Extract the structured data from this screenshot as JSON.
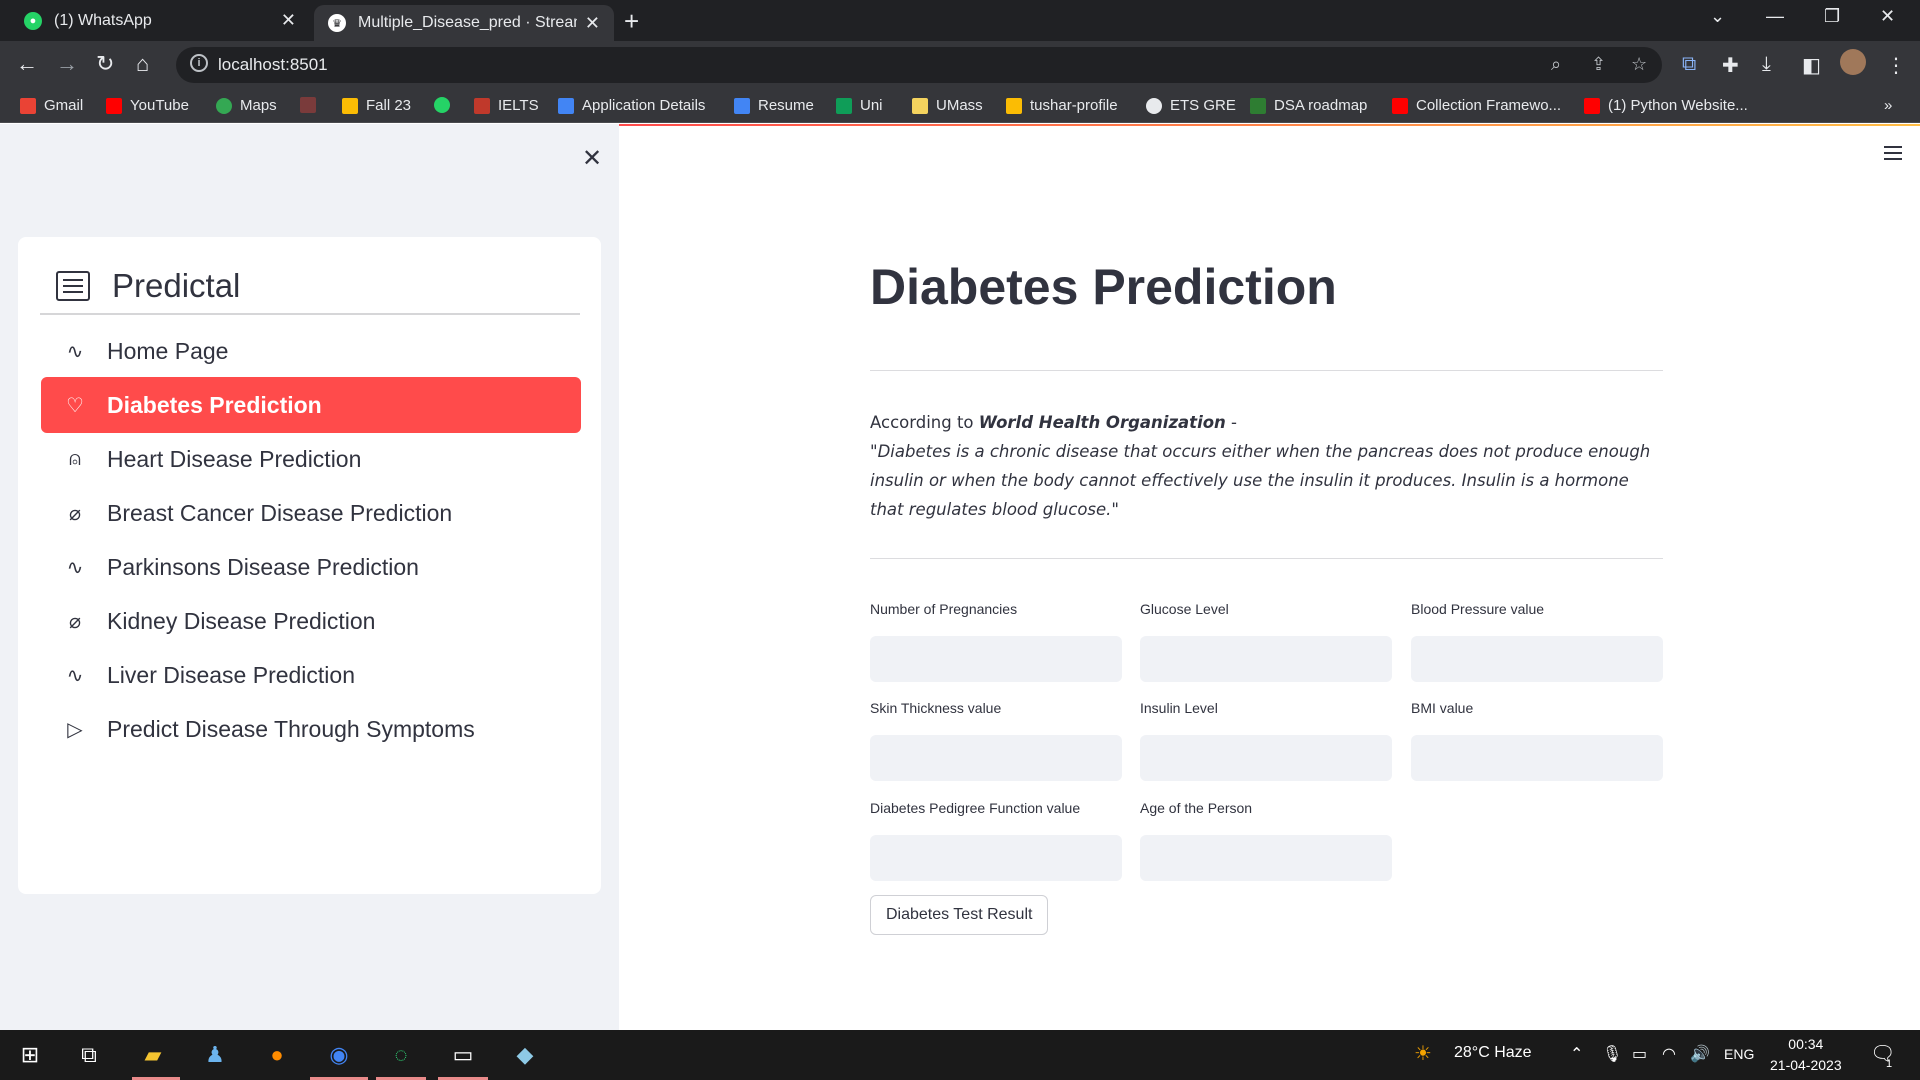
{
  "browser": {
    "tabs": [
      {
        "title": "(1) WhatsApp",
        "active": false
      },
      {
        "title": "Multiple_Disease_pred · Streamlit",
        "active": true
      }
    ],
    "url": "localhost:8501",
    "bookmarks": [
      "Gmail",
      "YouTube",
      "Maps",
      "Fall 23",
      "IELTS",
      "Application Details",
      "Resume",
      "Uni",
      "UMass",
      "tushar-profile",
      "ETS GRE",
      "DSA roadmap",
      "Collection Framewo...",
      "(1) Python Website..."
    ],
    "more_bookmarks": "»"
  },
  "sidebar": {
    "menu_title": "Predictal",
    "items": [
      {
        "label": "Home Page",
        "icon": "activity-icon",
        "active": false
      },
      {
        "label": "Diabetes Prediction",
        "icon": "heart-icon",
        "active": true
      },
      {
        "label": "Heart Disease Prediction",
        "icon": "person-icon",
        "active": false
      },
      {
        "label": "Breast Cancer Disease Prediction",
        "icon": "bandaid-icon",
        "active": false
      },
      {
        "label": "Parkinsons Disease Prediction",
        "icon": "activity-icon",
        "active": false
      },
      {
        "label": "Kidney Disease Prediction",
        "icon": "bandaid-icon",
        "active": false
      },
      {
        "label": "Liver Disease Prediction",
        "icon": "activity-icon",
        "active": false
      },
      {
        "label": "Predict Disease Through Symptoms",
        "icon": "play-icon",
        "active": false
      }
    ]
  },
  "main": {
    "title": "Diabetes Prediction",
    "intro_prefix": "According to ",
    "intro_source": "World Health Organization",
    "intro_suffix": " -",
    "quote": "\"Diabetes is a chronic disease that occurs either when the pancreas does not produce enough insulin or when the body cannot effectively use the insulin it produces. Insulin is a hormone that regulates blood glucose.\"",
    "fields": [
      {
        "label": "Number of Pregnancies",
        "value": ""
      },
      {
        "label": "Glucose Level",
        "value": ""
      },
      {
        "label": "Blood Pressure value",
        "value": ""
      },
      {
        "label": "Skin Thickness value",
        "value": ""
      },
      {
        "label": "Insulin Level",
        "value": ""
      },
      {
        "label": "BMI value",
        "value": ""
      },
      {
        "label": "Diabetes Pedigree Function value",
        "value": ""
      },
      {
        "label": "Age of the Person",
        "value": ""
      }
    ],
    "submit_label": "Diabetes Test Result"
  },
  "taskbar": {
    "weather": "28°C  Haze",
    "language": "ENG",
    "time": "00:34",
    "date": "21-04-2023",
    "notifications": "1"
  },
  "colors": {
    "accent": "#ff4b4b",
    "sidebar_bg": "#f0f2f6",
    "text": "#31333f"
  }
}
